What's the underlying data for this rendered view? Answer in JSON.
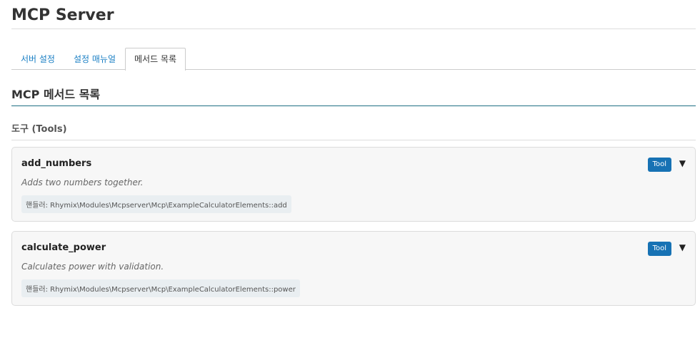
{
  "page": {
    "title": "MCP Server"
  },
  "tabs": [
    {
      "label": "서버 설정",
      "active": false
    },
    {
      "label": "설정 매뉴얼",
      "active": false
    },
    {
      "label": "메서드 목록",
      "active": true
    }
  ],
  "section": {
    "title": "MCP 메서드 목록"
  },
  "group": {
    "title": "도구 (Tools)"
  },
  "tools": [
    {
      "name": "add_numbers",
      "description": "Adds two numbers together.",
      "handler": "핸들러: Rhymix\\Modules\\Mcpserver\\Mcp\\ExampleCalculatorElements::add",
      "badge": "Tool",
      "toggle_icon": "caret-down-icon"
    },
    {
      "name": "calculate_power",
      "description": "Calculates power with validation.",
      "handler": "핸들러: Rhymix\\Modules\\Mcpserver\\Mcp\\ExampleCalculatorElements::power",
      "badge": "Tool",
      "toggle_icon": "caret-down-icon"
    }
  ],
  "colors": {
    "accent": "#1772b4",
    "link": "#1a7fc4",
    "section_rule": "#1f6f84"
  }
}
